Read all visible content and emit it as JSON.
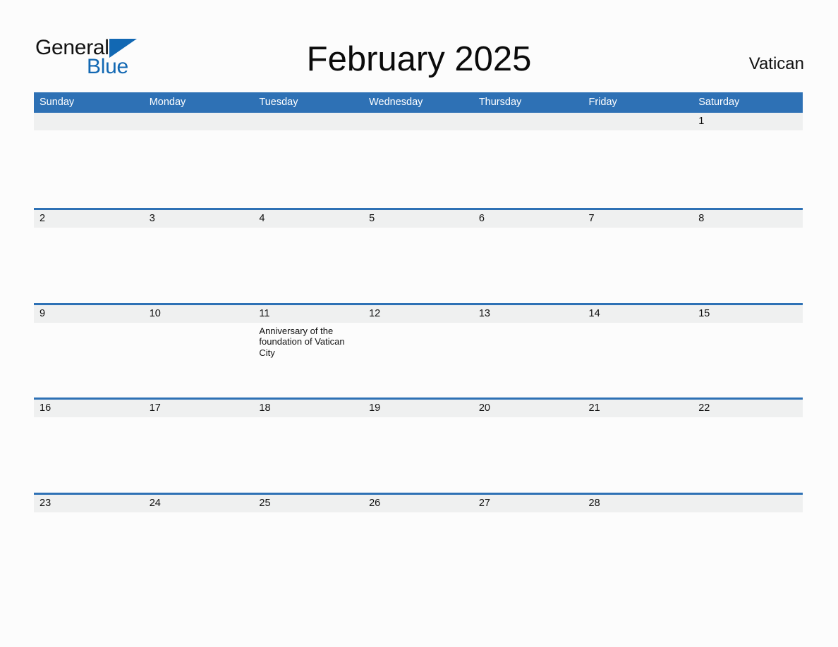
{
  "brand": {
    "name_part1": "General",
    "name_part2": "Blue",
    "triangle_color": "#1268b3"
  },
  "header": {
    "title": "February 2025",
    "locale": "Vatican"
  },
  "colors": {
    "header_blue": "#2e71b5",
    "row_gray": "#eff0f0",
    "page_background": "#fcfcfc",
    "text": "#101010"
  },
  "weekdays": [
    "Sunday",
    "Monday",
    "Tuesday",
    "Wednesday",
    "Thursday",
    "Friday",
    "Saturday"
  ],
  "weeks": [
    {
      "days": [
        {
          "number": "",
          "event": ""
        },
        {
          "number": "",
          "event": ""
        },
        {
          "number": "",
          "event": ""
        },
        {
          "number": "",
          "event": ""
        },
        {
          "number": "",
          "event": ""
        },
        {
          "number": "",
          "event": ""
        },
        {
          "number": "1",
          "event": ""
        }
      ]
    },
    {
      "days": [
        {
          "number": "2",
          "event": ""
        },
        {
          "number": "3",
          "event": ""
        },
        {
          "number": "4",
          "event": ""
        },
        {
          "number": "5",
          "event": ""
        },
        {
          "number": "6",
          "event": ""
        },
        {
          "number": "7",
          "event": ""
        },
        {
          "number": "8",
          "event": ""
        }
      ]
    },
    {
      "days": [
        {
          "number": "9",
          "event": ""
        },
        {
          "number": "10",
          "event": ""
        },
        {
          "number": "11",
          "event": "Anniversary of the foundation of Vatican City"
        },
        {
          "number": "12",
          "event": ""
        },
        {
          "number": "13",
          "event": ""
        },
        {
          "number": "14",
          "event": ""
        },
        {
          "number": "15",
          "event": ""
        }
      ]
    },
    {
      "days": [
        {
          "number": "16",
          "event": ""
        },
        {
          "number": "17",
          "event": ""
        },
        {
          "number": "18",
          "event": ""
        },
        {
          "number": "19",
          "event": ""
        },
        {
          "number": "20",
          "event": ""
        },
        {
          "number": "21",
          "event": ""
        },
        {
          "number": "22",
          "event": ""
        }
      ]
    },
    {
      "days": [
        {
          "number": "23",
          "event": ""
        },
        {
          "number": "24",
          "event": ""
        },
        {
          "number": "25",
          "event": ""
        },
        {
          "number": "26",
          "event": ""
        },
        {
          "number": "27",
          "event": ""
        },
        {
          "number": "28",
          "event": ""
        },
        {
          "number": "",
          "event": ""
        }
      ]
    }
  ]
}
